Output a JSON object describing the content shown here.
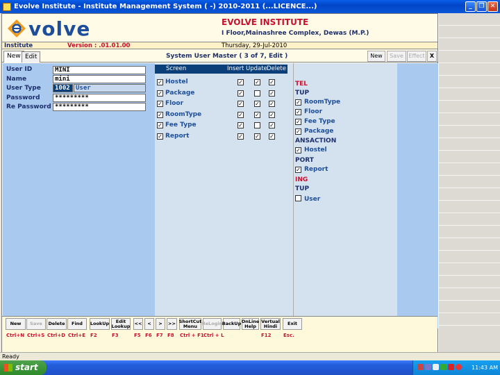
{
  "window": {
    "title": "Evolve Institute - Institute Management System ( -) 2010-2011 (...LICENCE...)"
  },
  "header": {
    "logo_text": "volve",
    "institute_name": "EVOLVE INSTITUTE",
    "address": "I Floor,Mainashree Complex, Dewas (M.P.)"
  },
  "infostrip": {
    "left": "Institute",
    "version": "Version : .01.01.00",
    "date": "Thursday, 29-Jul-2010"
  },
  "tabs": [
    {
      "label": "New"
    },
    {
      "label": "Edit"
    }
  ],
  "form_title": "System User Master  ( 3 of 7, Edit )",
  "toolbar": {
    "new_label": "New",
    "save_label": "Save",
    "effect_label": "Effect",
    "close_label": "X"
  },
  "fields": {
    "user_id_label": "User ID",
    "user_id_value": "MINI",
    "name_label": "Name",
    "name_value": "mini",
    "user_type_label": "User Type",
    "user_type_code": "1002",
    "user_type_value": "User",
    "password_label": "Password",
    "password_value": "*********",
    "repassword_label": "Re Password",
    "repassword_value": "*********"
  },
  "grid": {
    "headers": [
      "Screen",
      "Insert",
      "Update",
      "Delete"
    ],
    "rows": [
      {
        "screen": "Hostel",
        "checked": true,
        "insert": true,
        "update": true,
        "delete": true
      },
      {
        "screen": "Package",
        "checked": true,
        "insert": true,
        "update": false,
        "delete": true
      },
      {
        "screen": "Floor",
        "checked": true,
        "insert": true,
        "update": true,
        "delete": true
      },
      {
        "screen": "RoomType",
        "checked": true,
        "insert": true,
        "update": true,
        "delete": true
      },
      {
        "screen": "Fee Type",
        "checked": true,
        "insert": true,
        "update": false,
        "delete": true
      },
      {
        "screen": "Report",
        "checked": true,
        "insert": true,
        "update": true,
        "delete": true
      }
    ]
  },
  "tree": {
    "nodes": [
      {
        "text": "TEL",
        "kind": "head-red"
      },
      {
        "text": "TUP",
        "kind": "head"
      },
      {
        "text": "RoomType",
        "kind": "item",
        "checked": true
      },
      {
        "text": "Floor",
        "kind": "item",
        "checked": true
      },
      {
        "text": "Fee Type",
        "kind": "item",
        "checked": true
      },
      {
        "text": "Package",
        "kind": "item",
        "checked": true
      },
      {
        "text": "ANSACTION",
        "kind": "head"
      },
      {
        "text": "Hostel",
        "kind": "item",
        "checked": true
      },
      {
        "text": "PORT",
        "kind": "head"
      },
      {
        "text": "Report",
        "kind": "item",
        "checked": true
      },
      {
        "text": "ING",
        "kind": "head-red"
      },
      {
        "text": "TUP",
        "kind": "head"
      },
      {
        "text": "User",
        "kind": "item",
        "checked": false
      }
    ]
  },
  "function_buttons": [
    {
      "label": "New",
      "hotkey": "Ctrl+N",
      "enabled": true
    },
    {
      "label": "Save",
      "hotkey": "Ctrl+S",
      "enabled": false
    },
    {
      "label": "Delete",
      "hotkey": "Ctrl+D",
      "enabled": true
    },
    {
      "label": "Find",
      "hotkey": "Ctrl+E",
      "enabled": true
    },
    {
      "label": "LookUp",
      "hotkey": "F2",
      "enabled": true
    },
    {
      "label": "Edit Lookup",
      "hotkey": "F3",
      "enabled": true
    },
    {
      "label": "<<",
      "hotkey": "F5",
      "enabled": true
    },
    {
      "label": "<",
      "hotkey": "F6",
      "enabled": true
    },
    {
      "label": ">",
      "hotkey": "F7",
      "enabled": true
    },
    {
      "label": ">>",
      "hotkey": "F8",
      "enabled": true
    },
    {
      "label": "ShortCut Menu",
      "hotkey": "Ctrl + F1",
      "enabled": true
    },
    {
      "label": "ReLogin",
      "hotkey": "Ctrl + L",
      "enabled": false
    },
    {
      "label": "BackUp",
      "hotkey": "",
      "enabled": true
    },
    {
      "label": "OnLine Help",
      "hotkey": "",
      "enabled": true
    },
    {
      "label": "Vertual Hindi",
      "hotkey": "F12",
      "enabled": true
    },
    {
      "label": "Exit",
      "hotkey": "Esc.",
      "enabled": true
    }
  ],
  "status": {
    "text": "Ready"
  },
  "taskbar": {
    "start_label": "start",
    "clock": "11:43 AM"
  },
  "colors": {
    "accent_red": "#c8102e",
    "navy": "#1d2f6b",
    "panel_blue": "#a9c9ee",
    "grid_header": "#0b3f7a"
  }
}
